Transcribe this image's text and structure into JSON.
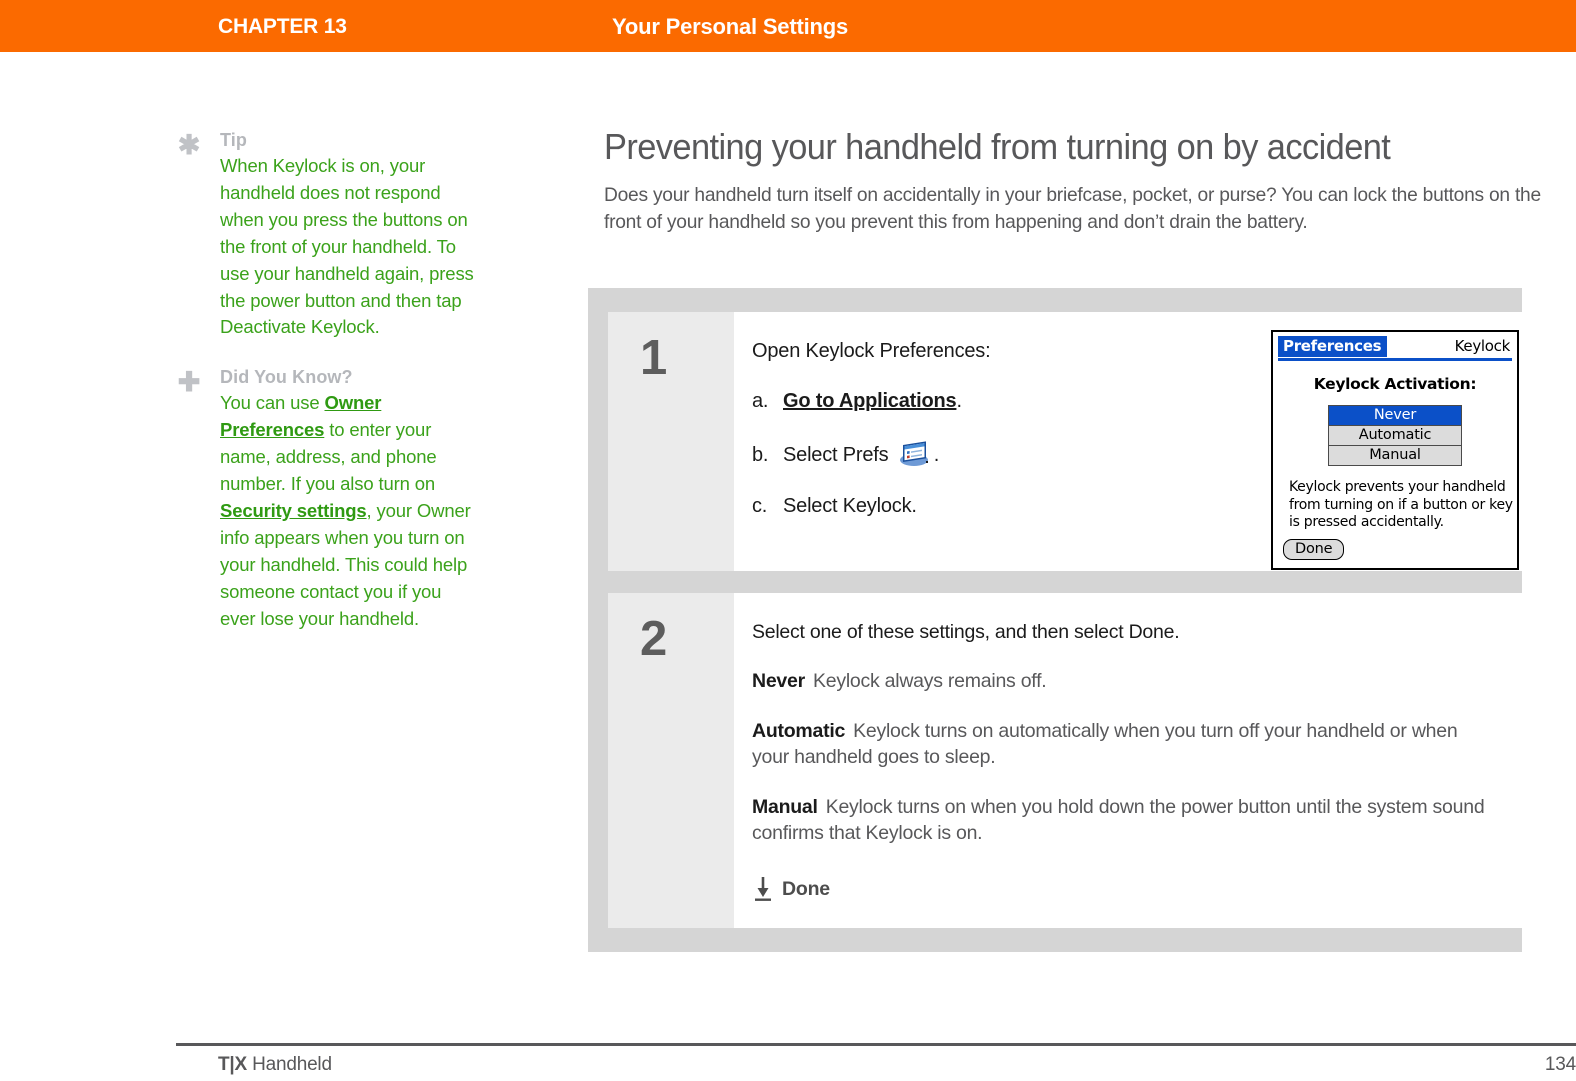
{
  "header": {
    "chapter": "CHAPTER 13",
    "section": "Your Personal Settings",
    "bar_color": "#fb6a00"
  },
  "sidebar": {
    "tips": [
      {
        "icon": "asterisk-icon",
        "glyph": "✱",
        "heading": "Tip",
        "text_before": "When Keylock is on, your handheld does not respond when you press the buttons on the front of your handheld. To use your handheld again, press the power button and then tap Deactivate Keylock."
      },
      {
        "icon": "plus-icon",
        "glyph": "✚",
        "heading": "Did You Know?",
        "seg1": "You can use ",
        "link1": "Owner Preferences",
        "seg2": " to enter your name, address, and phone number. If you also turn on ",
        "link2": "Security settings",
        "seg3": ", your Owner info appears when you turn on your handheld. This could help someone contact you if you ever lose your handheld."
      }
    ],
    "text_color": "#3ba21b",
    "heading_color": "#b5b7bb"
  },
  "main": {
    "title": "Preventing your handheld from turning on by accident",
    "intro": "Does your handheld turn itself on accidentally in your briefcase, pocket, or purse? You can lock the buttons on the front of your handheld so you prevent this from happening and don’t drain the battery."
  },
  "steps": [
    {
      "number": "1",
      "lead": "Open Keylock Preferences:",
      "items": [
        {
          "marker": "a.",
          "prefix": "",
          "link": "Go to Applications",
          "suffix": "."
        },
        {
          "marker": "b.",
          "prefix": "Select Prefs ",
          "link": "",
          "suffix": "."
        },
        {
          "marker": "c.",
          "prefix": "Select Keylock.",
          "link": "",
          "suffix": ""
        }
      ],
      "icon_name": "prefs-app-icon"
    },
    {
      "number": "2",
      "lead": "Select one of these settings, and then select Done.",
      "options": [
        {
          "term": "Never",
          "desc": "Keylock always remains off."
        },
        {
          "term": "Automatic",
          "desc": "Keylock turns on automatically when you turn off your handheld or when your handheld goes to sleep."
        },
        {
          "term": "Manual",
          "desc": "Keylock turns on when you hold down the power button until the system sound confirms that Keylock is on."
        }
      ],
      "done_label": "Done"
    }
  ],
  "palm_screenshot": {
    "app_name": "Preferences",
    "screen_name": "Keylock",
    "heading": "Keylock Activation:",
    "options": [
      {
        "label": "Never",
        "selected": true
      },
      {
        "label": "Automatic",
        "selected": false
      },
      {
        "label": "Manual",
        "selected": false
      }
    ],
    "description": "Keylock prevents your handheld from turning on if a button or key is pressed accidentally.",
    "done_button": "Done",
    "highlight_color": "#0b50c8"
  },
  "footer": {
    "product_mark": "T|X",
    "product_rest": " Handheld",
    "page_number": "134"
  }
}
